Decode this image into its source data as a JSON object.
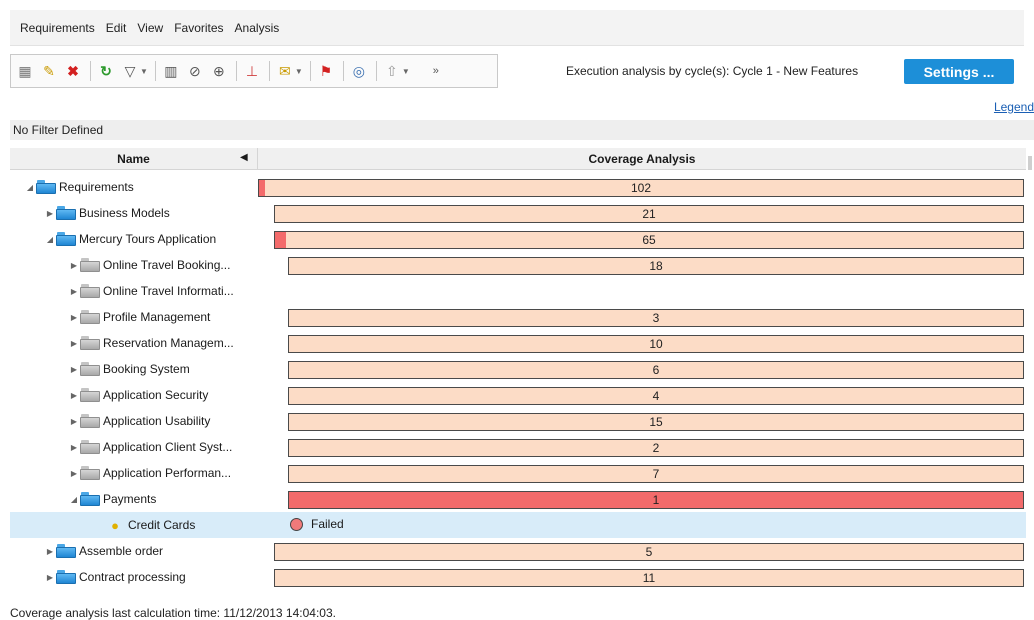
{
  "menu": [
    "Requirements",
    "Edit",
    "View",
    "Favorites",
    "Analysis"
  ],
  "toolbar": {
    "icons": [
      "new-folder-icon",
      "new-requirement-icon",
      "delete-icon",
      "refresh-icon",
      "filter-icon",
      "columns-icon",
      "attachment-icon",
      "zoom-icon",
      "pin-icon",
      "mail-icon",
      "flag-icon",
      "find-icon",
      "up-arrow-icon",
      "more-icon"
    ]
  },
  "execution_label": "Execution analysis by cycle(s): Cycle 1 - New Features",
  "settings_label": "Settings ...",
  "legend_label": "Legend",
  "filter_text": "No Filter Defined",
  "columns": {
    "name": "Name",
    "coverage": "Coverage Analysis"
  },
  "colors": {
    "accent": "#1d8fd8",
    "bar_fill": "#fcdcc6",
    "failed": "#f36b6b",
    "selected_row": "#d8ecf9"
  },
  "rows": [
    {
      "label": "Requirements",
      "expander": "expanded",
      "icon": "blue-folder-open-icon",
      "coverage": "102",
      "failed_fraction": 0.008
    },
    {
      "label": "Business Models",
      "expander": "collapsed",
      "icon": "blue-folder-icon",
      "coverage": "21",
      "failed_fraction": 0
    },
    {
      "label": "Mercury Tours Application",
      "expander": "expanded",
      "icon": "blue-folder-open-icon",
      "coverage": "65",
      "failed_fraction": 0.015
    },
    {
      "label": "Online Travel Booking...",
      "expander": "collapsed",
      "icon": "gray-folder-icon",
      "coverage": "18",
      "failed_fraction": 0
    },
    {
      "label": "Online Travel Informati...",
      "expander": "collapsed",
      "icon": "gray-folder-icon",
      "coverage": "",
      "failed_fraction": 0
    },
    {
      "label": "Profile Management",
      "expander": "collapsed",
      "icon": "gray-folder-icon",
      "coverage": "3",
      "failed_fraction": 0
    },
    {
      "label": "Reservation Managem...",
      "expander": "collapsed",
      "icon": "gray-folder-icon",
      "coverage": "10",
      "failed_fraction": 0
    },
    {
      "label": "Booking System",
      "expander": "collapsed",
      "icon": "gray-folder-icon",
      "coverage": "6",
      "failed_fraction": 0
    },
    {
      "label": "Application Security",
      "expander": "collapsed",
      "icon": "gray-folder-icon",
      "coverage": "4",
      "failed_fraction": 0
    },
    {
      "label": "Application Usability",
      "expander": "collapsed",
      "icon": "gray-folder-icon",
      "coverage": "15",
      "failed_fraction": 0
    },
    {
      "label": "Application Client Syst...",
      "expander": "collapsed",
      "icon": "gray-folder-icon",
      "coverage": "2",
      "failed_fraction": 0
    },
    {
      "label": "Application Performan...",
      "expander": "collapsed",
      "icon": "gray-folder-icon",
      "coverage": "7",
      "failed_fraction": 0
    },
    {
      "label": "Payments",
      "expander": "expanded",
      "icon": "blue-folder-open-icon",
      "coverage": "1",
      "failed_fraction": 1
    },
    {
      "label": "Credit Cards",
      "expander": "none",
      "icon": "requirement-bulb-icon",
      "status": "Failed",
      "selected": true
    },
    {
      "label": "Assemble order",
      "expander": "collapsed",
      "icon": "blue-folder-icon",
      "coverage": "5",
      "failed_fraction": 0
    },
    {
      "label": "Contract processing",
      "expander": "collapsed",
      "icon": "blue-folder-icon",
      "coverage": "11",
      "failed_fraction": 0
    }
  ],
  "footer_text": "Coverage analysis last calculation time: 11/12/2013 14:04:03."
}
